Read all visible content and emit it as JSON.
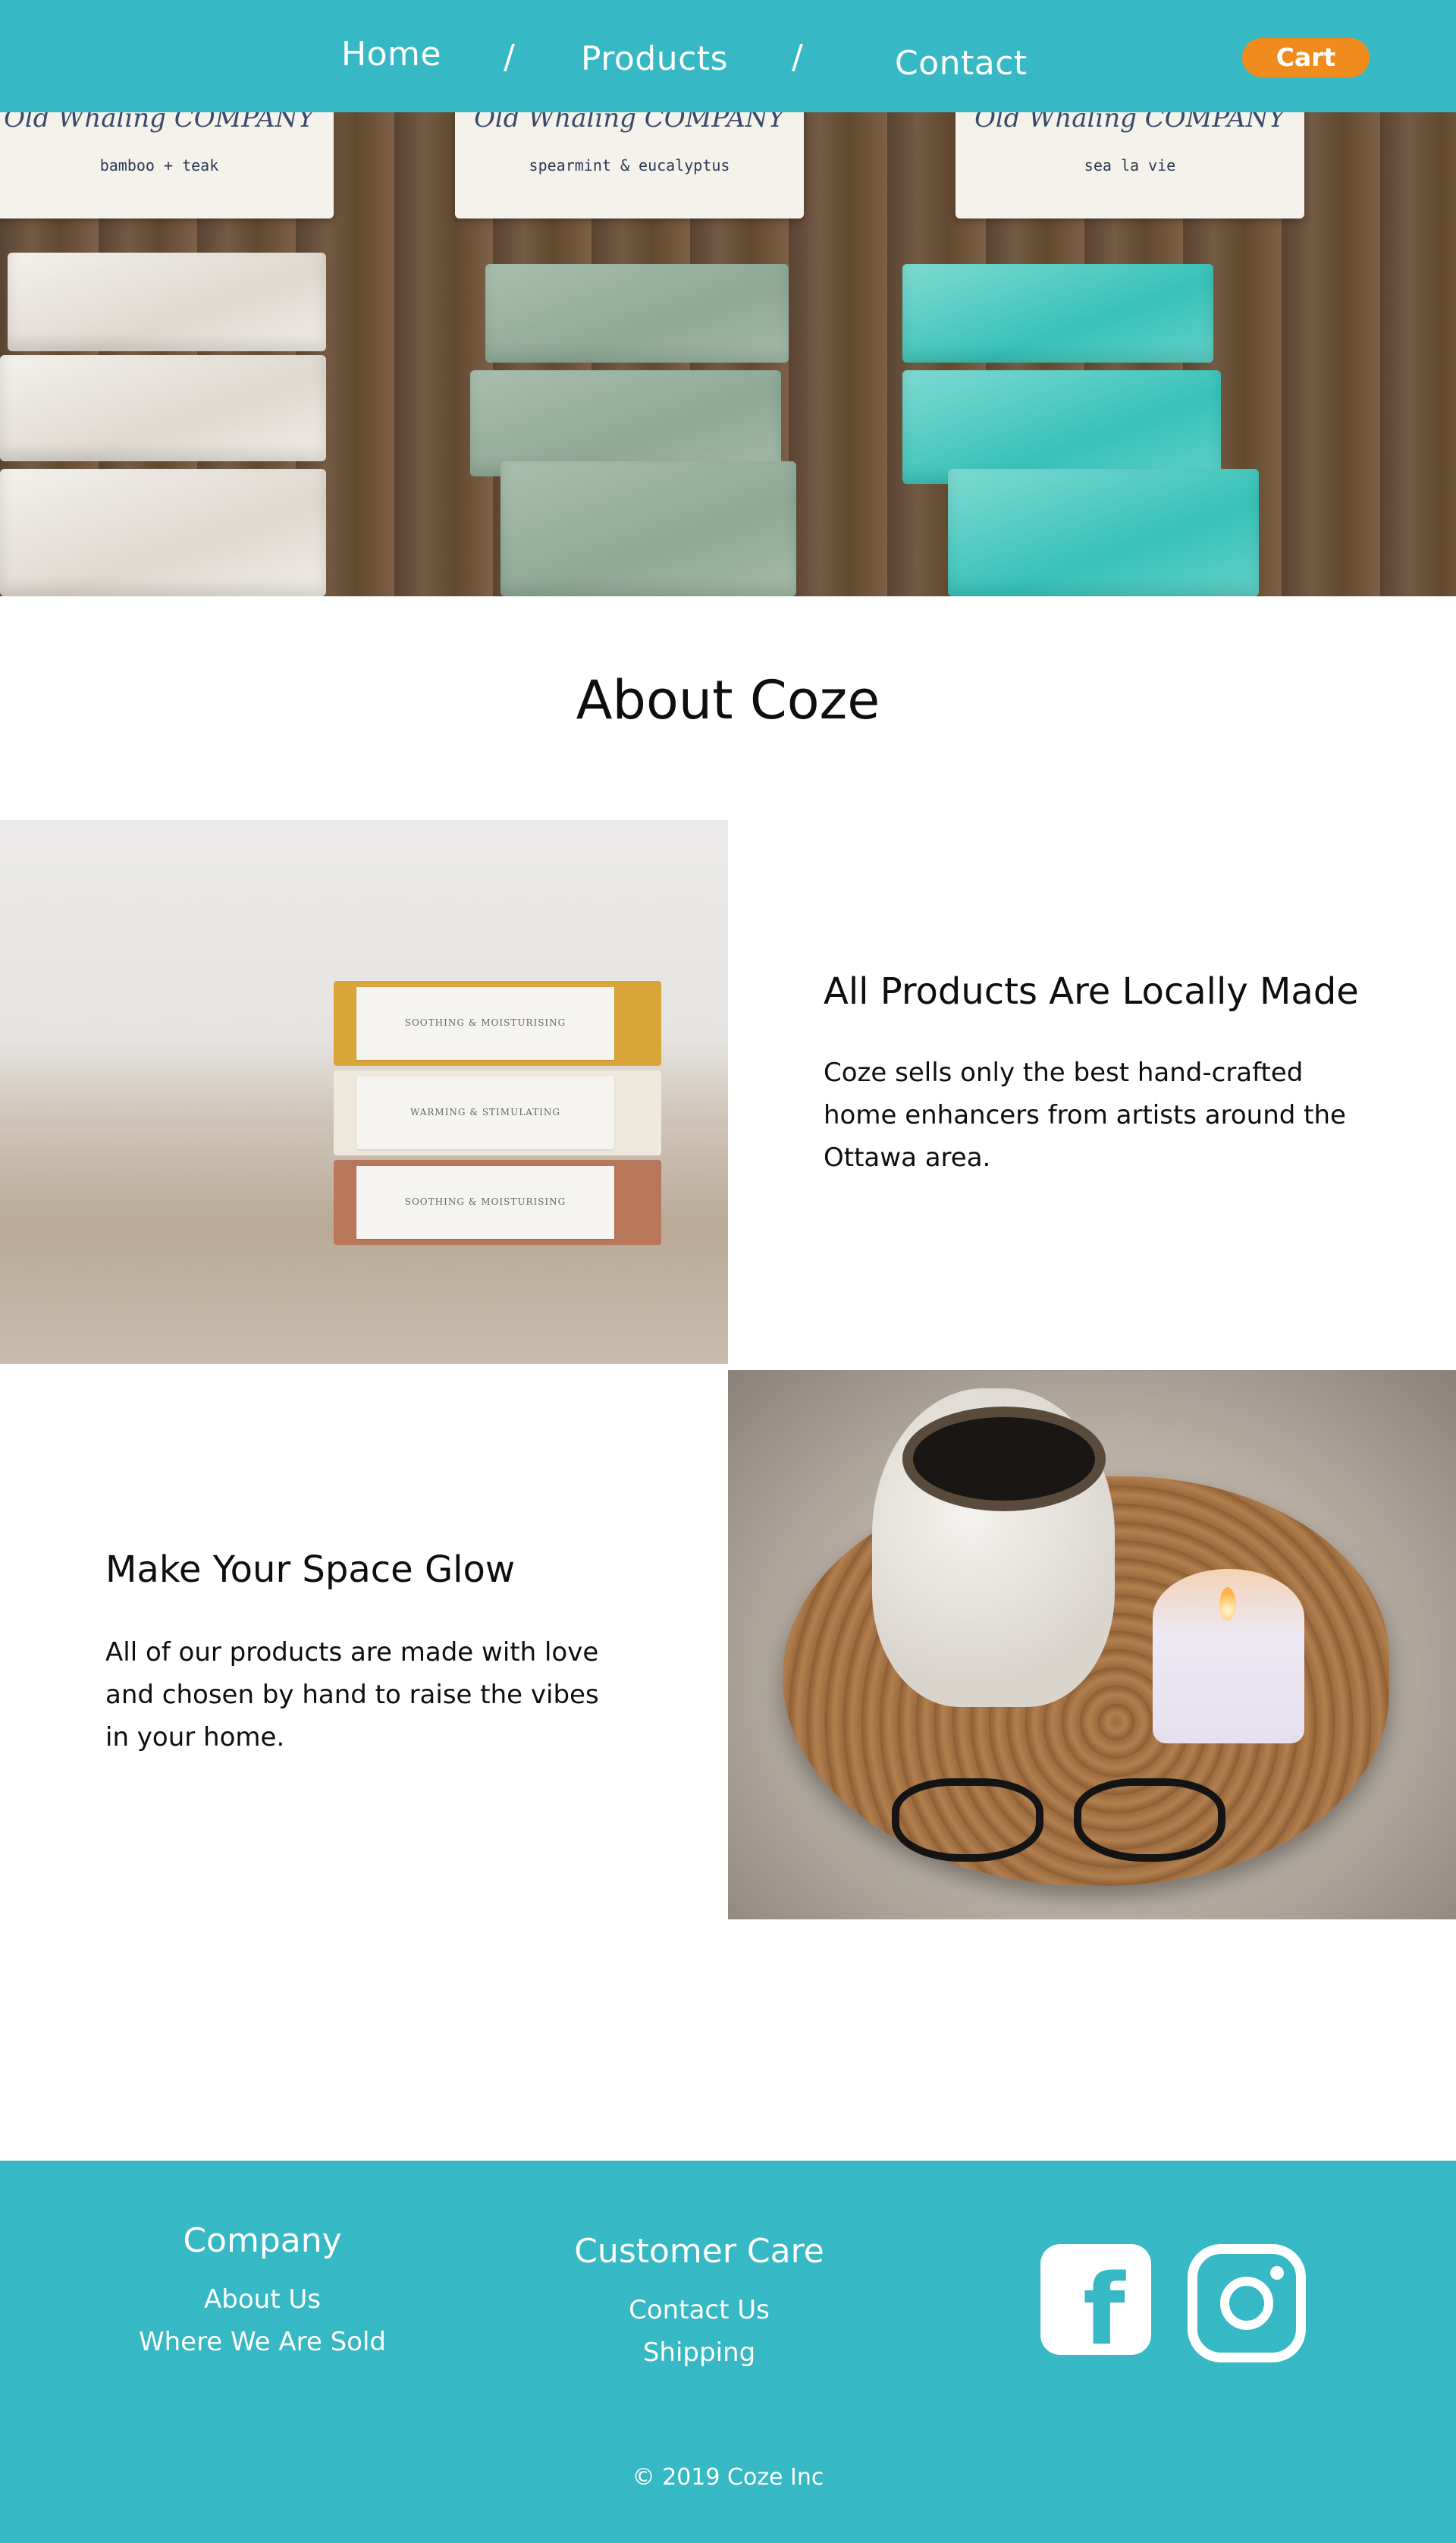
{
  "nav": {
    "home": "Home",
    "separator": "/",
    "products": "Products",
    "contact": "Contact",
    "cart": "Cart"
  },
  "hero": {
    "box_brand": "Old Whaling COMPANY",
    "boxes": [
      {
        "scent": "bamboo + teak"
      },
      {
        "scent": "spearmint & eucalyptus"
      },
      {
        "scent": "sea la vie"
      }
    ]
  },
  "about": {
    "title": "About Coze"
  },
  "feature_local": {
    "title": "All Products Are Locally Made",
    "body": "Coze sells only the best hand-crafted home enhancers from artists around the Ottawa area.",
    "soap_labels": [
      "SOOTHING & MOISTURISING",
      "WARMING & STIMULATING",
      "SOOTHING & MOISTURISING"
    ]
  },
  "feature_glow": {
    "title": "Make Your Space Glow",
    "body": "All of our products are made with love and chosen by hand to raise the vibes in your home."
  },
  "footer": {
    "company": {
      "heading": "Company",
      "links": [
        "About Us",
        "Where We Are Sold"
      ]
    },
    "customer_care": {
      "heading": "Customer Care",
      "links": [
        "Contact Us",
        "Shipping"
      ]
    },
    "social": {
      "facebook_icon": "facebook-icon",
      "instagram_icon": "instagram-icon"
    },
    "copyright": "© 2019 Coze Inc"
  },
  "colors": {
    "brand_teal": "#36b9c4",
    "cart_orange": "#f08c1e"
  }
}
